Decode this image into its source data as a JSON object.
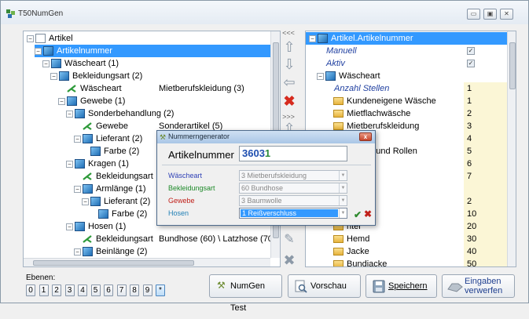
{
  "app": {
    "title": "T50NumGen"
  },
  "window_buttons": [
    "▭",
    "▣",
    "✕"
  ],
  "left_tree": {
    "rows": [
      {
        "label": "Artikel",
        "value": "",
        "selected": false,
        "italic": false,
        "indent": 0,
        "icon": "table-icon",
        "expand": "−"
      },
      {
        "label": "Artikelnummer",
        "value": "",
        "selected": true,
        "italic": false,
        "indent": 1,
        "icon": "cube-icon",
        "expand": "−"
      },
      {
        "label": "Wäscheart (1)",
        "value": "",
        "selected": false,
        "italic": false,
        "indent": 2,
        "icon": "cube-icon",
        "expand": "−"
      },
      {
        "label": "Bekleidungsart (2)",
        "value": "",
        "selected": false,
        "italic": false,
        "indent": 3,
        "icon": "cube-icon",
        "expand": "−"
      },
      {
        "label": "Wäscheart",
        "value": "Mietberufskleidung (3)",
        "selected": false,
        "italic": false,
        "indent": 4,
        "icon": "leaf-icon",
        "expand": ""
      },
      {
        "label": "Gewebe (1)",
        "value": "",
        "selected": false,
        "italic": false,
        "indent": 4,
        "icon": "cube-icon",
        "expand": "−"
      },
      {
        "label": "Sonderbehandlung (2)",
        "value": "",
        "selected": false,
        "italic": false,
        "indent": 5,
        "icon": "cube-icon",
        "expand": "−"
      },
      {
        "label": "Gewebe",
        "value": "Sonderartikel (5)",
        "selected": false,
        "italic": false,
        "indent": 6,
        "icon": "leaf-icon",
        "expand": ""
      },
      {
        "label": "Lieferant (2)",
        "value": "",
        "selected": false,
        "italic": false,
        "indent": 6,
        "icon": "cube-icon",
        "expand": "−"
      },
      {
        "label": "Farbe (2)",
        "value": "",
        "selected": false,
        "italic": false,
        "indent": 7,
        "icon": "cube-icon",
        "expand": ""
      },
      {
        "label": "Kragen (1)",
        "value": "",
        "selected": false,
        "italic": false,
        "indent": 5,
        "icon": "cube-icon",
        "expand": "−"
      },
      {
        "label": "Bekleidungsart",
        "value": "",
        "selected": false,
        "italic": false,
        "indent": 6,
        "icon": "leaf-icon",
        "expand": ""
      },
      {
        "label": "Armlänge (1)",
        "value": "",
        "selected": false,
        "italic": false,
        "indent": 6,
        "icon": "cube-icon",
        "expand": "−"
      },
      {
        "label": "Lieferant (2)",
        "value": "",
        "selected": false,
        "italic": false,
        "indent": 7,
        "icon": "cube-icon",
        "expand": "−"
      },
      {
        "label": "Farbe (2)",
        "value": "",
        "selected": false,
        "italic": false,
        "indent": 8,
        "icon": "cube-icon",
        "expand": ""
      },
      {
        "label": "Hosen (1)",
        "value": "",
        "selected": false,
        "italic": false,
        "indent": 5,
        "icon": "cube-icon",
        "expand": "−"
      },
      {
        "label": "Bekleidungsart",
        "value": "Bundhose (60) \\ Latzhose (70)",
        "selected": false,
        "italic": false,
        "indent": 6,
        "icon": "leaf-icon",
        "expand": ""
      },
      {
        "label": "Beinlänge (2)",
        "value": "",
        "selected": false,
        "italic": false,
        "indent": 6,
        "icon": "cube-icon",
        "expand": "−"
      },
      {
        "label": "Lieferant (2)",
        "value": "",
        "selected": false,
        "italic": false,
        "indent": 7,
        "icon": "cube-icon",
        "expand": "−"
      }
    ]
  },
  "middle_controls": {
    "top_label": "<<<",
    "lower_label": ">>>"
  },
  "right_tree": {
    "rows": [
      {
        "label": "Artikel.Artikelnummer",
        "value": "",
        "selected": true,
        "italic": false,
        "indent": 0,
        "icon": "cube-icon",
        "expand": "−",
        "check": ""
      },
      {
        "label": "Manuell",
        "value": "",
        "selected": false,
        "italic": true,
        "indent": 1,
        "icon": "",
        "expand": "",
        "check": "✓"
      },
      {
        "label": "Aktiv",
        "value": "",
        "selected": false,
        "italic": true,
        "indent": 1,
        "icon": "",
        "expand": "",
        "check": "✓"
      },
      {
        "label": "Wäscheart",
        "value": "",
        "selected": false,
        "italic": false,
        "indent": 1,
        "icon": "cube-icon",
        "expand": "−",
        "check": ""
      },
      {
        "label": "Anzahl Stellen",
        "value": "1",
        "selected": false,
        "italic": true,
        "indent": 2,
        "icon": "",
        "expand": "",
        "check": ""
      },
      {
        "label": "Kundeneigene Wäsche",
        "value": "1",
        "selected": false,
        "italic": false,
        "indent": 2,
        "icon": "folder-icon",
        "expand": "",
        "check": ""
      },
      {
        "label": "Mietflachwäsche",
        "value": "2",
        "selected": false,
        "italic": false,
        "indent": 2,
        "icon": "folder-icon",
        "expand": "",
        "check": ""
      },
      {
        "label": "Mietberufskleidung",
        "value": "3",
        "selected": false,
        "italic": false,
        "indent": 2,
        "icon": "folder-icon",
        "expand": "",
        "check": ""
      },
      {
        "label": "atten",
        "value": "4",
        "selected": false,
        "italic": false,
        "indent": 2,
        "icon": "folder-icon",
        "expand": "",
        "check": ""
      },
      {
        "label": "pender und Rollen",
        "value": "5",
        "selected": false,
        "italic": false,
        "indent": 2,
        "icon": "folder-icon",
        "expand": "",
        "check": ""
      },
      {
        "label": "n",
        "value": "6",
        "selected": false,
        "italic": false,
        "indent": 2,
        "icon": "folder-icon",
        "expand": "",
        "check": ""
      },
      {
        "label": "",
        "value": "7",
        "selected": false,
        "italic": false,
        "indent": 2,
        "icon": "folder-icon",
        "expand": "",
        "check": ""
      },
      {
        "label": "art",
        "value": "",
        "selected": false,
        "italic": false,
        "indent": 1,
        "icon": "cube-icon",
        "expand": "−",
        "check": ""
      },
      {
        "label": "",
        "value": "2",
        "selected": false,
        "italic": false,
        "indent": 2,
        "icon": "",
        "expand": "",
        "check": ""
      },
      {
        "label": "ntel",
        "value": "10",
        "selected": false,
        "italic": false,
        "indent": 2,
        "icon": "folder-icon",
        "expand": "",
        "check": ""
      },
      {
        "label": "ntel",
        "value": "20",
        "selected": false,
        "italic": false,
        "indent": 2,
        "icon": "folder-icon",
        "expand": "",
        "check": ""
      },
      {
        "label": "Hemd",
        "value": "30",
        "selected": false,
        "italic": false,
        "indent": 2,
        "icon": "folder-icon",
        "expand": "",
        "check": ""
      },
      {
        "label": "Jacke",
        "value": "40",
        "selected": false,
        "italic": false,
        "indent": 2,
        "icon": "folder-icon",
        "expand": "",
        "check": ""
      },
      {
        "label": "Bundjacke",
        "value": "50",
        "selected": false,
        "italic": false,
        "indent": 2,
        "icon": "folder-icon",
        "expand": "",
        "check": ""
      }
    ]
  },
  "dialog": {
    "title": "Nummerngenerator",
    "number_label": "Artikelnummer",
    "number_prefix": "3603",
    "number_suffix": "1",
    "fields": [
      {
        "label": "Wäscheart",
        "value": "3 Mietberufskleidung",
        "label_color": "#2d3fb5",
        "active": false
      },
      {
        "label": "Bekleidungsart",
        "value": "60 Bundhose",
        "label_color": "#1e8a2a",
        "active": false
      },
      {
        "label": "Gewebe",
        "value": "3 Baumwolle",
        "label_color": "#c0201a",
        "active": false
      },
      {
        "label": "Hosen",
        "value": "1 Reißverschluss",
        "label_color": "#1f7fb5",
        "active": true
      }
    ],
    "ok_glyph": "✔",
    "cancel_glyph": "✖"
  },
  "bottom": {
    "ebenen_label": "Ebenen:",
    "levels": [
      "0",
      "1",
      "2",
      "3",
      "4",
      "5",
      "6",
      "7",
      "8",
      "9",
      "*"
    ],
    "buttons": {
      "numgen_test": "NumGen Test",
      "vorschau": "Vorschau",
      "speichern": "Speichern",
      "eingaben_line1": "Eingaben",
      "eingaben_line2": "verwerfen"
    }
  },
  "colors": {
    "selection": "#3399ff",
    "value_highlight": "#fbf6d6"
  }
}
